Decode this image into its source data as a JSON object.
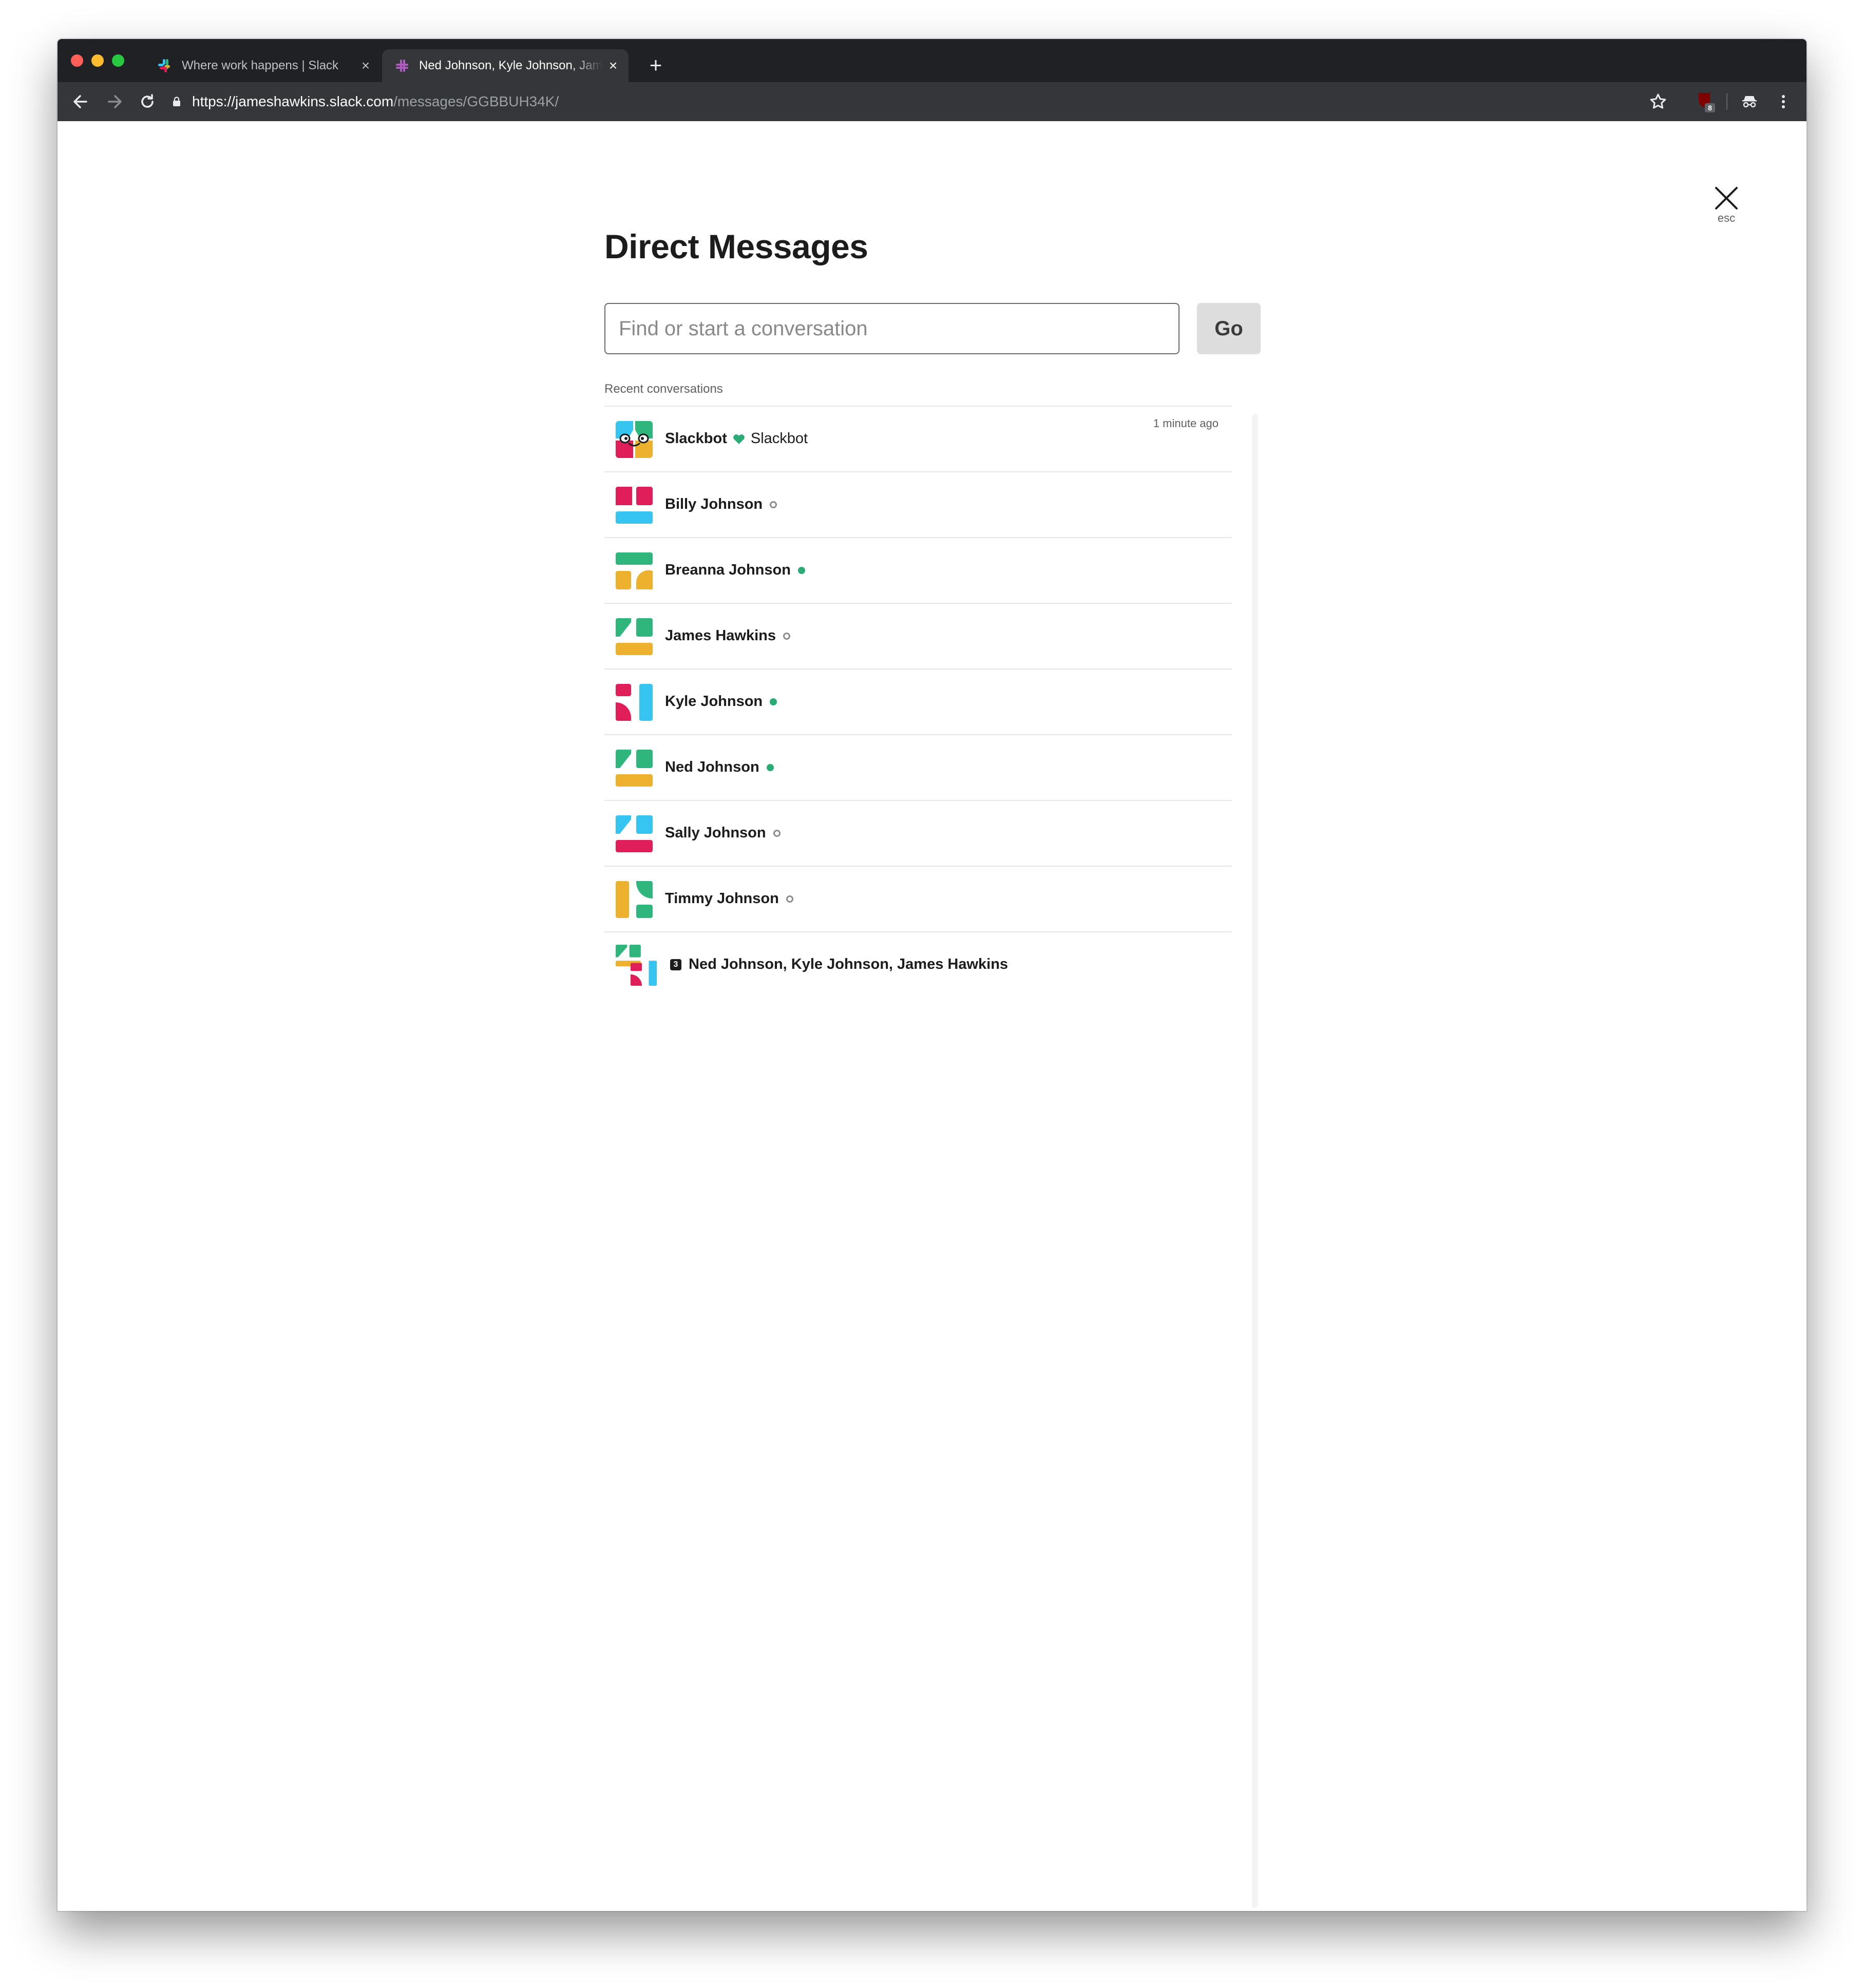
{
  "browser": {
    "tabs": [
      {
        "title": "Where work happens | Slack",
        "active": false
      },
      {
        "title": "Ned Johnson, Kyle Johnson, James Hawkins",
        "active": true
      }
    ],
    "close_glyph": "×",
    "new_tab_glyph": "+",
    "url_host": "https://jameshawkins.slack.com",
    "url_path": "/messages/GGBBUH34K/",
    "extension_badge_count": "8"
  },
  "page": {
    "close_hint": "esc",
    "heading": "Direct Messages",
    "search_placeholder": "Find or start a conversation",
    "go_label": "Go",
    "section_label": "Recent conversations",
    "conversations": [
      {
        "name": "Slackbot",
        "status": "bot",
        "subtitle": "Slackbot",
        "time": "1 minute ago"
      },
      {
        "name": "Billy Johnson",
        "status": "away"
      },
      {
        "name": "Breanna Johnson",
        "status": "active"
      },
      {
        "name": "James Hawkins",
        "status": "away"
      },
      {
        "name": "Kyle Johnson",
        "status": "active"
      },
      {
        "name": "Ned Johnson",
        "status": "active"
      },
      {
        "name": "Sally Johnson",
        "status": "away"
      },
      {
        "name": "Timmy Johnson",
        "status": "away"
      },
      {
        "name": "Ned Johnson, Kyle Johnson, James Hawkins",
        "status": "group",
        "member_count": "3"
      }
    ]
  },
  "colors": {
    "slack_green": "#2eb67d",
    "slack_red": "#e01e5a",
    "slack_blue": "#36c5f0",
    "slack_yellow": "#ecb22e",
    "presence_active": "#2bac76"
  }
}
